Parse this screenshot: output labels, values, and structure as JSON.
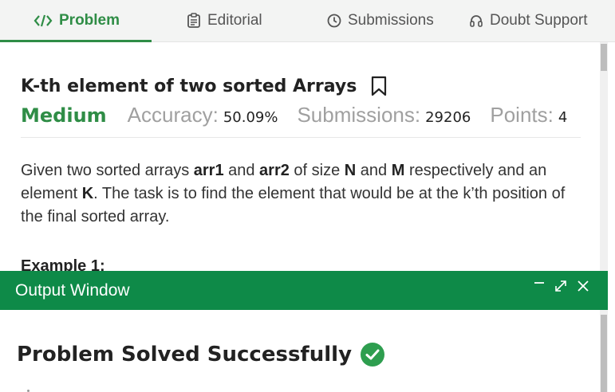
{
  "tabs": [
    {
      "label": "Problem",
      "icon": "code-icon",
      "active": true
    },
    {
      "label": "Editorial",
      "icon": "document-icon",
      "active": false
    },
    {
      "label": "Submissions",
      "icon": "clock-icon",
      "active": false
    },
    {
      "label": "Doubt Support",
      "icon": "headset-icon",
      "active": false
    }
  ],
  "problem": {
    "title": "K-th element of two sorted Arrays",
    "difficulty": "Medium",
    "accuracy_label": "Accuracy:",
    "accuracy_value": "50.09%",
    "submissions_label": "Submissions:",
    "submissions_value": "29206",
    "points_label": "Points:",
    "points_value": "4",
    "description": {
      "p1": "Given two sorted arrays ",
      "arr1": "arr1",
      "p2": " and ",
      "arr2": "arr2",
      "p3": " of size ",
      "n": "N",
      "p4": " and ",
      "m": "M",
      "p5": " respectively and an element ",
      "k": "K",
      "p6": ". The task is to find the element that would be at the k’th position of the final sorted array."
    },
    "example_heading": "Example 1:"
  },
  "output_window": {
    "title": "Output Window",
    "result": "Problem Solved Successfully"
  },
  "colors": {
    "accent": "#2f8d46",
    "output_header": "#0e8a48",
    "success": "#2e9e4f"
  }
}
